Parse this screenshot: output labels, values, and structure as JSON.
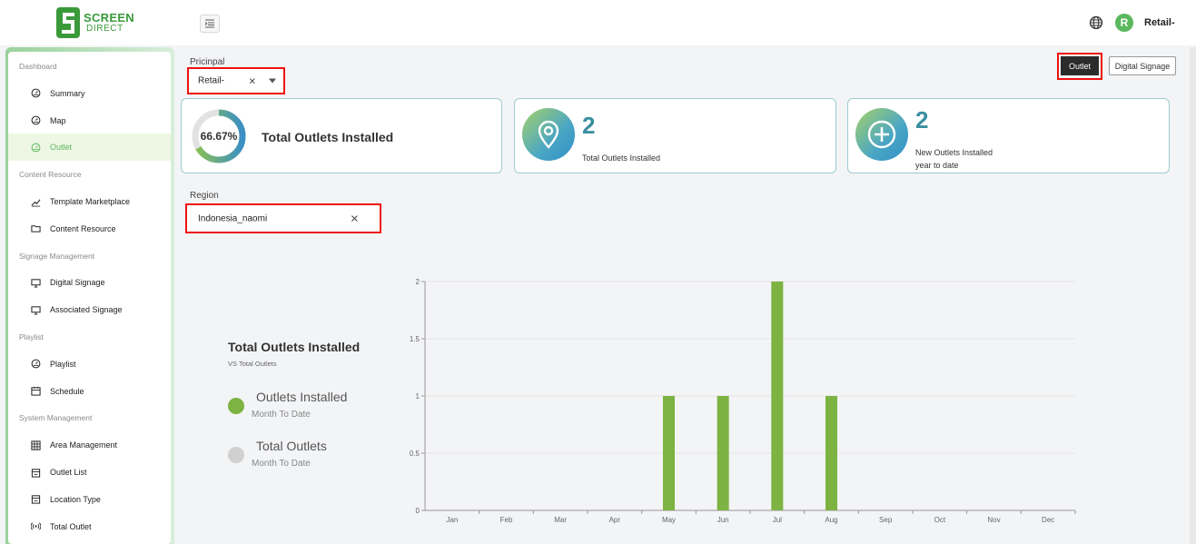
{
  "brand": {
    "line1": "SCREEN",
    "line2": "DIRECT"
  },
  "header": {
    "avatar_initial": "R",
    "user_name": "Retail-"
  },
  "sidebar": {
    "items": [
      {
        "kind": "section",
        "label": "Dashboard"
      },
      {
        "kind": "item",
        "label": "Summary",
        "icon": "gauge-icon"
      },
      {
        "kind": "item",
        "label": "Map",
        "icon": "gauge-icon"
      },
      {
        "kind": "item",
        "label": "Outlet",
        "icon": "gauge-icon",
        "active": true
      },
      {
        "kind": "section",
        "label": "Content Resource"
      },
      {
        "kind": "item",
        "label": "Template Marketplace",
        "icon": "chart-line-icon"
      },
      {
        "kind": "item",
        "label": "Content Resource",
        "icon": "folder-icon"
      },
      {
        "kind": "section",
        "label": "Signage Management"
      },
      {
        "kind": "item",
        "label": "Digital Signage",
        "icon": "monitor-icon"
      },
      {
        "kind": "item",
        "label": "Associated Signage",
        "icon": "monitor-icon"
      },
      {
        "kind": "section",
        "label": "Playlist"
      },
      {
        "kind": "item",
        "label": "Playlist",
        "icon": "gauge-icon"
      },
      {
        "kind": "item",
        "label": "Schedule",
        "icon": "calendar-icon"
      },
      {
        "kind": "section",
        "label": "System Management"
      },
      {
        "kind": "item",
        "label": "Area Management",
        "icon": "grid-icon"
      },
      {
        "kind": "item",
        "label": "Outlet List",
        "icon": "store-icon"
      },
      {
        "kind": "item",
        "label": "Location Type",
        "icon": "store-icon"
      },
      {
        "kind": "item",
        "label": "Total Outlet",
        "icon": "signal-icon"
      }
    ]
  },
  "filters": {
    "principal_label": "Pricinpal",
    "principal_value": "Retail-",
    "region_label": "Region",
    "region_value": "Indonesia_naomi"
  },
  "view_toggle": {
    "outlet": "Outlet",
    "digital_signage": "Digital Signage",
    "selected": "Outlet"
  },
  "cards": [
    {
      "percent": "66.67%",
      "percent_value": 66.67,
      "title": "Total Outlets Installed"
    },
    {
      "value": "2",
      "label": "Total Outlets Installed",
      "icon": "map-pin-icon"
    },
    {
      "value": "2",
      "label_line1": "New Outlets Installed",
      "label_line2": "year to date",
      "icon": "plus-circle-icon"
    }
  ],
  "legend": {
    "title": "Total Outlets Installed",
    "subtitle": "VS Total Outlets",
    "items": [
      {
        "name": "Outlets Installed",
        "sub": "Month To Date",
        "color": "#7cb342"
      },
      {
        "name": "Total Outlets",
        "sub": "Month To Date",
        "color": "#d0d0d0"
      }
    ]
  },
  "colors": {
    "accent": "#5cb85c",
    "bar": "#7cb342",
    "highlight_border": "#e11111"
  },
  "chart_data": {
    "type": "bar",
    "categories": [
      "Jan",
      "Feb",
      "Mar",
      "Apr",
      "May",
      "Jun",
      "Jul",
      "Aug",
      "Sep",
      "Oct",
      "Nov",
      "Dec"
    ],
    "series": [
      {
        "name": "Outlets Installed",
        "values": [
          0,
          0,
          0,
          0,
          1,
          1,
          2,
          1,
          0,
          0,
          0,
          0
        ],
        "color": "#7cb342"
      }
    ],
    "ylim": [
      0,
      2
    ],
    "yticks": [
      "0",
      "0.5",
      "1",
      "1.5",
      "2"
    ],
    "grid": true
  }
}
